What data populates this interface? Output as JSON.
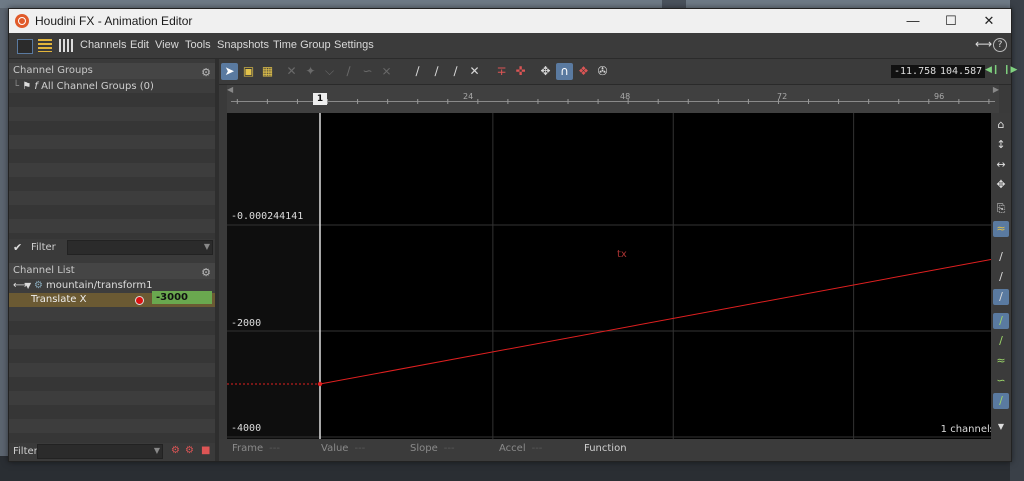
{
  "window": {
    "title": "Houdini FX - Animation Editor"
  },
  "menu": {
    "items": [
      "Channels",
      "Edit",
      "View",
      "Tools",
      "Snapshots",
      "Time Group",
      "Settings"
    ]
  },
  "channel_groups": {
    "header": "Channel Groups",
    "items": [
      "All Channel Groups (0)"
    ]
  },
  "filter": {
    "label": "Filter",
    "value": ""
  },
  "channel_list": {
    "header": "Channel List",
    "node_path": "mountain/transform1",
    "channel_name": "Translate X",
    "channel_value": "-3000"
  },
  "bottom_filter": {
    "label": "Filter"
  },
  "time_range": {
    "start": "-11.758",
    "end": "104.587"
  },
  "ruler": {
    "ticks": [
      "24",
      "48",
      "72",
      "96"
    ],
    "current_frame": "1"
  },
  "graph": {
    "y_labels": [
      "-0.000244141",
      "-2000",
      "-4000"
    ],
    "curve_label": "tx",
    "channels_count": "1 channels",
    "curve_color": "#e02020"
  },
  "chart_data": {
    "type": "line",
    "series": [
      {
        "name": "tx",
        "x": [
          1,
          96
        ],
        "y": [
          -3000,
          -500
        ]
      }
    ],
    "x_ticks": [
      24,
      48,
      72,
      96
    ],
    "y_ticks": [
      -4000,
      -2000,
      -0.000244141
    ]
  },
  "status": {
    "frame_label": "Frame",
    "frame_value": "---",
    "value_label": "Value",
    "value_value": "---",
    "slope_label": "Slope",
    "slope_value": "---",
    "accel_label": "Accel",
    "accel_value": "---",
    "function_label": "Function"
  },
  "colors": {
    "accent": "#5a7aa0",
    "value_box": "#6aa84f",
    "curve": "#e02020"
  }
}
